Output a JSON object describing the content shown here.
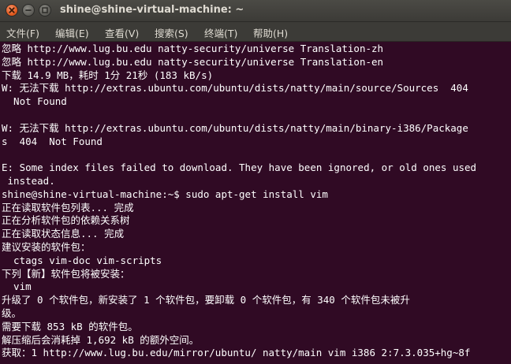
{
  "window": {
    "title": "shine@shine-virtual-machine: ~"
  },
  "menubar": {
    "items": [
      "文件(F)",
      "编辑(E)",
      "查看(V)",
      "搜索(S)",
      "终端(T)",
      "帮助(H)"
    ]
  },
  "terminal": {
    "lines": [
      "忽略 http://www.lug.bu.edu natty-security/universe Translation-zh",
      "忽略 http://www.lug.bu.edu natty-security/universe Translation-en",
      "下载 14.9 MB，耗时 1分 21秒 (183 kB/s)",
      "W: 无法下载 http://extras.ubuntu.com/ubuntu/dists/natty/main/source/Sources  404",
      "  Not Found",
      "",
      "W: 无法下载 http://extras.ubuntu.com/ubuntu/dists/natty/main/binary-i386/Package",
      "s  404  Not Found",
      "",
      "E: Some index files failed to download. They have been ignored, or old ones used",
      " instead.",
      "shine@shine-virtual-machine:~$ sudo apt-get install vim",
      "正在读取软件包列表... 完成",
      "正在分析软件包的依赖关系树",
      "正在读取状态信息... 完成",
      "建议安装的软件包：",
      "  ctags vim-doc vim-scripts",
      "下列【新】软件包将被安装：",
      "  vim",
      "升级了 0 个软件包，新安装了 1 个软件包，要卸载 0 个软件包，有 340 个软件包未被升",
      "级。",
      "需要下载 853 kB 的软件包。",
      "解压缩后会消耗掉 1,692 kB 的额外空间。",
      "获取：1 http://www.lug.bu.edu/mirror/ubuntu/ natty/main vim i386 2:7.3.035+hg~8f"
    ]
  },
  "colors": {
    "terminal_background": "#300a24",
    "terminal_text": "#ffffff",
    "titlebar_background": "#3c3b37",
    "close_button": "#e35b20"
  }
}
